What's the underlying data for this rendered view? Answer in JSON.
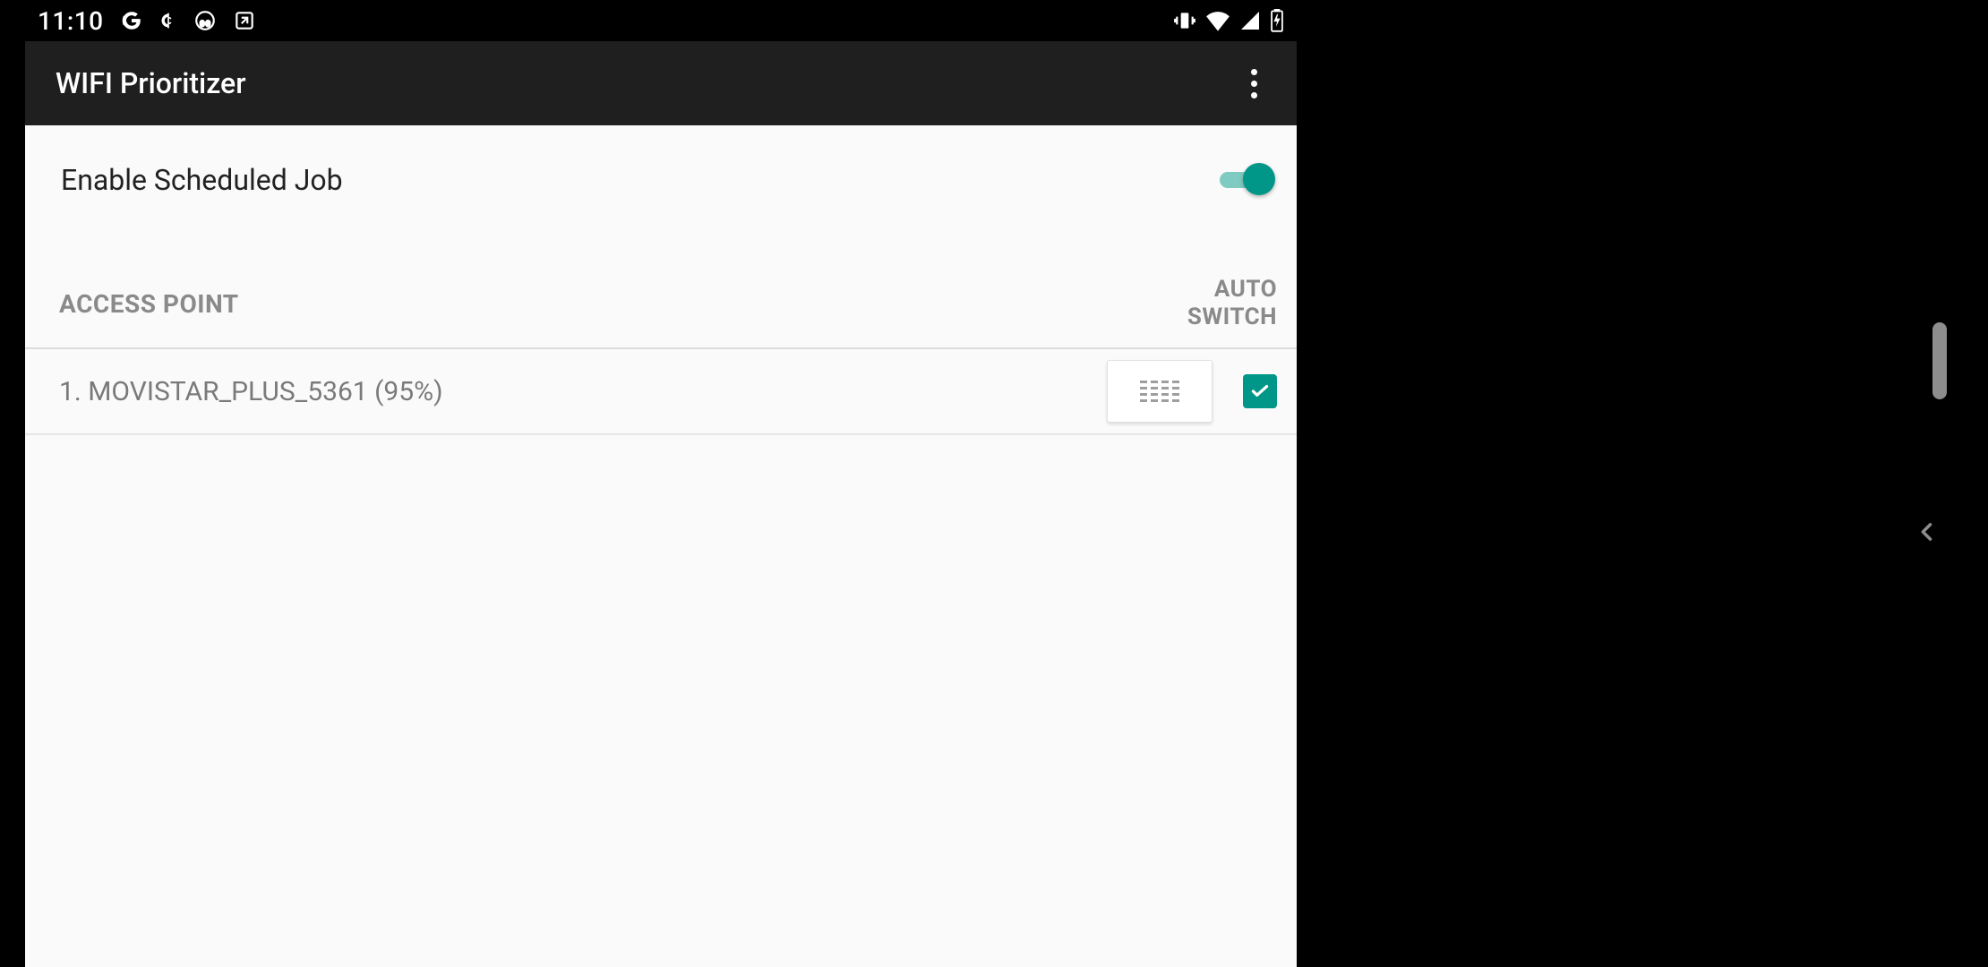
{
  "statusbar": {
    "time": "11:10",
    "icons_left": [
      "google",
      "cents",
      "headphones",
      "square-arrow"
    ],
    "icons_right": [
      "vibrate",
      "wifi",
      "cell",
      "battery-charging"
    ]
  },
  "appbar": {
    "title": "WIFI Prioritizer"
  },
  "settings": {
    "enable_scheduled_job_label": "Enable Scheduled Job",
    "enable_scheduled_job_on": true
  },
  "list": {
    "header_access_point": "ACCESS POINT",
    "header_auto_switch_line1": "AUTO",
    "header_auto_switch_line2": "SWITCH",
    "items": [
      {
        "index": 1,
        "display": "1. MOVISTAR_PLUS_5361 (95%)",
        "ssid": "MOVISTAR_PLUS_5361",
        "signal_percent": 95,
        "auto_switch": true
      }
    ]
  },
  "colors": {
    "accent": "#009688",
    "appbar": "#1f1f1f",
    "bg": "#fafafa"
  }
}
